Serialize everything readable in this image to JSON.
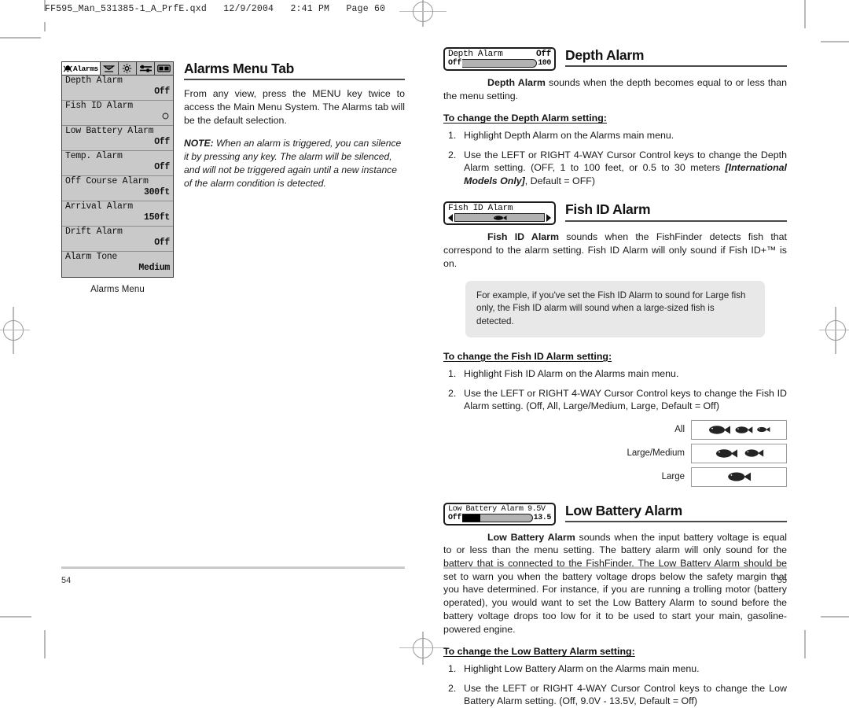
{
  "document": {
    "header": "FF595_Man_531385-1_A_PrfE.qxd   12/9/2004   2:41 PM   Page 60",
    "page_left_number": "54",
    "page_right_number": "55"
  },
  "left_page": {
    "lcd_menu": {
      "tabs": [
        {
          "label": "Alarms",
          "icon": "alarm-bell-icon",
          "active": true
        },
        {
          "label": "",
          "icon": "sonar-icon",
          "active": false
        },
        {
          "label": "",
          "icon": "brightness-icon",
          "active": false
        },
        {
          "label": "",
          "icon": "setup-sliders-icon",
          "active": false
        },
        {
          "label": "",
          "icon": "views-icon",
          "active": false
        }
      ],
      "rows": [
        {
          "label": "Depth Alarm",
          "value": "Off"
        },
        {
          "label": "Fish ID Alarm",
          "value": "",
          "glyph": "fish-circle-icon"
        },
        {
          "label": "Low Battery Alarm",
          "value": "Off"
        },
        {
          "label": "Temp. Alarm",
          "value": "Off"
        },
        {
          "label": "Off Course Alarm",
          "value": "300ft"
        },
        {
          "label": "Arrival Alarm",
          "value": "150ft"
        },
        {
          "label": "Drift Alarm",
          "value": "Off"
        },
        {
          "label": "Alarm Tone",
          "value": "Medium"
        }
      ],
      "caption": "Alarms Menu"
    },
    "section": {
      "title": "Alarms Menu Tab",
      "intro": "From any view, press the MENU key twice to access the Main Menu System. The Alarms tab will be the default selection.",
      "note_lead": "NOTE:",
      "note_body": " When an alarm is triggered, you can silence it by pressing any key.  The alarm will be silenced, and will not be triggered again until a new instance of the alarm condition is detected."
    }
  },
  "right_page": {
    "depth_alarm": {
      "widget": {
        "title": "Depth Alarm",
        "value": "Off",
        "bar_min_label": "Off",
        "bar_max_label": "100",
        "bar_fill_percent": 0
      },
      "title": "Depth Alarm",
      "lead": "Depth Alarm",
      "body": " sounds when the depth becomes equal to or less than the menu setting.",
      "howto": "To change the Depth Alarm setting:",
      "steps": [
        {
          "num": "1.",
          "text": "Highlight Depth Alarm on the Alarms main menu."
        },
        {
          "num": "2.",
          "text_pre": "Use the LEFT or RIGHT 4-WAY Cursor Control keys to change the Depth Alarm setting. (OFF, 1 to 100 feet, or 0.5 to 30 meters ",
          "text_italic": "[International Models Only]",
          "text_post": ", Default = OFF)"
        }
      ]
    },
    "fish_id_alarm": {
      "widget": {
        "title": "Fish ID Alarm",
        "left_arrow": "left-arrow-icon",
        "right_arrow": "right-arrow-icon",
        "fish_glyph": "fish-icon"
      },
      "title": "Fish ID Alarm",
      "lead": "Fish ID Alarm",
      "body": " sounds when the FishFinder detects fish that correspond to the alarm setting. Fish ID Alarm will only sound if Fish ID+™ is on.",
      "callout": "For example, if you've set the Fish ID Alarm to sound for Large fish only, the Fish ID alarm will sound when a large-sized fish is detected.",
      "howto": "To change the Fish ID Alarm setting:",
      "steps": [
        {
          "num": "1.",
          "text": "Highlight Fish ID Alarm on the Alarms main menu."
        },
        {
          "num": "2.",
          "text": "Use the LEFT or RIGHT 4-WAY Cursor Control keys to change the Fish ID Alarm setting. (Off, All, Large/Medium, Large, Default = Off)"
        }
      ],
      "size_legend": [
        {
          "label": "All",
          "fish_count": 3
        },
        {
          "label": "Large/Medium",
          "fish_count": 2
        },
        {
          "label": "Large",
          "fish_count": 1
        }
      ]
    },
    "low_battery_alarm": {
      "widget": {
        "title": "Low Battery Alarm 9.5V",
        "bar_min_label": "Off",
        "bar_max_label": "13.5",
        "bar_fill_percent": 26
      },
      "title": "Low Battery Alarm",
      "lead": "Low Battery Alarm",
      "body": " sounds when the input battery voltage is equal to or less than the menu setting. The battery alarm will only sound for the battery that is connected to the  FishFinder. The Low Battery Alarm should be set to warn you when the battery voltage drops below the safety margin that you have determined. For instance, if you are running a trolling motor (battery operated), you would want to set the Low Battery Alarm to sound before the battery voltage drops too low for it to be used to start your main, gasoline-powered engine.",
      "howto": "To change the Low Battery Alarm setting:",
      "steps": [
        {
          "num": "1.",
          "text": "Highlight Low Battery Alarm on the Alarms main menu."
        },
        {
          "num": "2.",
          "text": "Use the LEFT or RIGHT 4-WAY Cursor Control keys to change the Low Battery Alarm setting. (Off, 9.0V - 13.5V,  Default = Off)"
        }
      ]
    }
  },
  "colors": {
    "lcd_background": "#c9c9c9",
    "callout_background": "#e8e8e8",
    "rule": "#4a4a4a",
    "crop_mark": "#b9b9b9"
  }
}
